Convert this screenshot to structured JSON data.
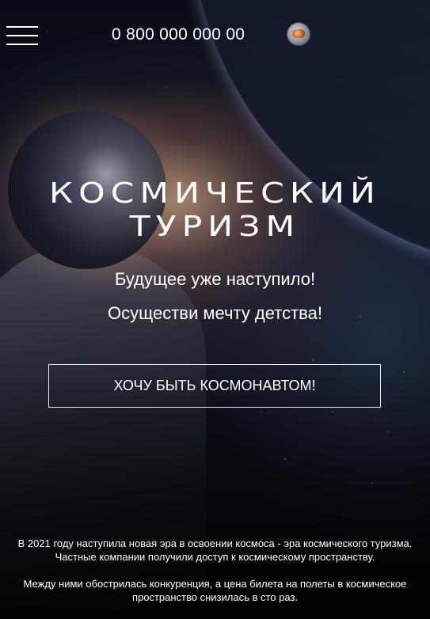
{
  "header": {
    "phone": "0 800 000 000 00",
    "lang_icon": "planet-flag-icon"
  },
  "hero": {
    "title_line_1": "Космический",
    "title_line_2": "туризм",
    "subtitle_1": "Будущее уже наступило!",
    "subtitle_2": "Осуществи мечту детства!",
    "cta_label": "ХОЧУ БЫТЬ КОСМОНАВТОМ!"
  },
  "description": {
    "paragraph_1_line_1": "В 2021 году наступила новая эра в освоении космоса - эра космического туризма.",
    "paragraph_1_line_2": "Частные компании получили доступ к космическому пространству.",
    "paragraph_2_line_1": "Между ними обострилась конкуренция, а цена билета на полеты в космическое",
    "paragraph_2_line_2": "пространство снизилась в сто раз."
  },
  "colors": {
    "text": "#ffffff",
    "background": "#06080d"
  }
}
